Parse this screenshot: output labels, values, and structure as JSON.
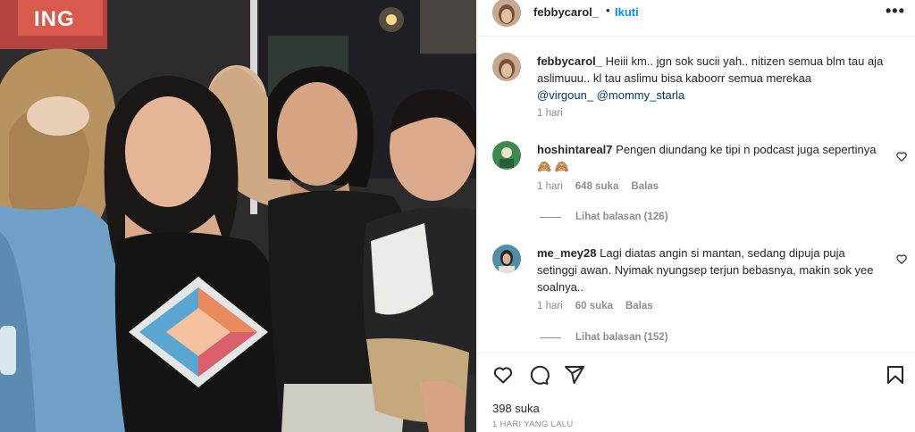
{
  "photo": {
    "sign_text": "ING"
  },
  "post": {
    "username": "febbycarol_",
    "dot": "•",
    "follow_label": "Ikuti",
    "more_icon": "more-horizontal-icon"
  },
  "caption": {
    "username": "febbycarol_",
    "text": "Heiii km.. jgn sok sucii yah.. nitizen semua blm tau aja aslimuuu.. kl tau aslimu bisa kaboorr semua merekaa",
    "mention1": "@virgoun_",
    "mention2": "@mommy_starla",
    "time": "1 hari"
  },
  "comments": [
    {
      "username": "hoshintareal7",
      "text": "Pengen diundang ke tipi n podcast juga sepertinya 🙈 🙈",
      "time": "1 hari",
      "likes": "648 suka",
      "reply": "Balas",
      "view_replies": "Lihat balasan (126)"
    },
    {
      "username": "me_mey28",
      "text": "Lagi diatas angin si mantan, sedang dipuja puja setinggi awan. Nyimak nyungsep terjun bebasnya, makin sok yee soalnya..",
      "time": "1 hari",
      "likes": "60 suka",
      "reply": "Balas",
      "view_replies": "Lihat balasan (152)"
    }
  ],
  "footer": {
    "likes": "398 suka",
    "timestamp": "1 HARI YANG LALU"
  },
  "icons": [
    "heart-icon",
    "comment-icon",
    "share-icon",
    "bookmark-icon"
  ],
  "colors": {
    "follow": "#0095f6",
    "mention": "#00376b",
    "muted": "#8e8e8e",
    "text": "#262626"
  }
}
